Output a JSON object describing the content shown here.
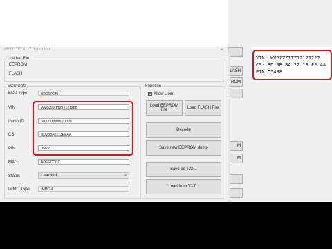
{
  "dialog": {
    "title": "MED17EDC17 dump tool"
  },
  "loaded_file": {
    "group_label": "Loaded File",
    "eeprom_label": "EEPROM",
    "flash_label": "FLASH"
  },
  "ecu_data": {
    "group_label": "ECU Data",
    "ecu_type": {
      "label": "ECU Type",
      "value": "EDC17C46"
    },
    "vin": {
      "label": "VIN",
      "value": "WVGZZZ1TZ12121222"
    },
    "immo_id": {
      "label": "Immo ID",
      "value": "0000000000000000"
    },
    "cs": {
      "label": "CS",
      "value": "BD9BBA2213EEAA"
    },
    "pin": {
      "label": "PIN",
      "value": "05488"
    },
    "mac": {
      "label": "MAC",
      "value": "ADEECCCC"
    },
    "status": {
      "label": "Status",
      "value": "Learned"
    },
    "immo_type": {
      "label": "IMMO Type",
      "value": "IMMO 4"
    }
  },
  "function": {
    "group_label": "Function",
    "allow_user_label": "Allow User",
    "allow_user_checked": true,
    "load_eeprom_label": "Load EEPROM File",
    "load_flash_label": "Load FLASH File",
    "decode_label": "Decode",
    "save_eeprom_label": "Save new EEPROM dump",
    "save_txt_label": "Save as TXT...",
    "load_txt_label": "Load from TXT..."
  },
  "right_panel": {
    "buttons": [
      "",
      "LASH",
      "ROM",
      "",
      "M",
      "M",
      "",
      ""
    ]
  },
  "notepad": {
    "lines": [
      "VIN: WVGZZZ1TZ12121222",
      "CS: BD 9B BA 22 13 EE AA",
      "PIN:O5488"
    ]
  },
  "colors": {
    "highlight": "#d6141e",
    "dialog_bg": "#f0f0f0"
  }
}
